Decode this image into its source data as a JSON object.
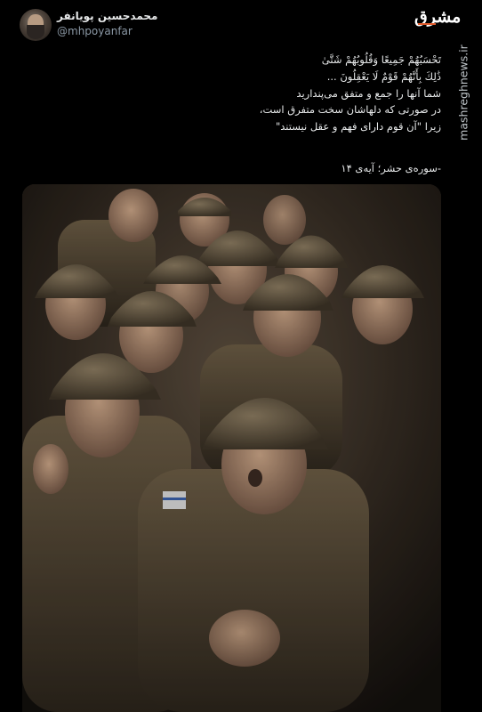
{
  "user": {
    "display_name": "محمدحسین پویانفر",
    "handle": "@mhpoyanfar",
    "avatar_icon": "profile-avatar"
  },
  "branding": {
    "logo_text": "مشرق",
    "logo_color": "#ffffff",
    "logo_accent": "#e25b2c",
    "watermark": "mashreghnews.ir"
  },
  "tweet": {
    "lines": [
      "تَحْسَبُهُمْ جَمِيعًا وَقُلُوبُهُمْ شَتَّىٰ",
      "ذَٰلِكَ بِأَنَّهُمْ قَوْمٌ لَا يَعْقِلُونَ ...",
      "شما آنها را جمع و متفق می‌پندارید",
      "در صورتی که دلهاشان سخت متفرق است،",
      "زیرا \"آن قوم دارای فهم و عقل نیستند\""
    ],
    "reference": "-سوره‌ی حشر؛ آیه‌ی ۱۴"
  },
  "media": {
    "icon": "photo-soldiers-in-helmets"
  },
  "colors": {
    "background": "#000000",
    "text": "#e7e9ea",
    "secondary": "#8b98a5"
  }
}
